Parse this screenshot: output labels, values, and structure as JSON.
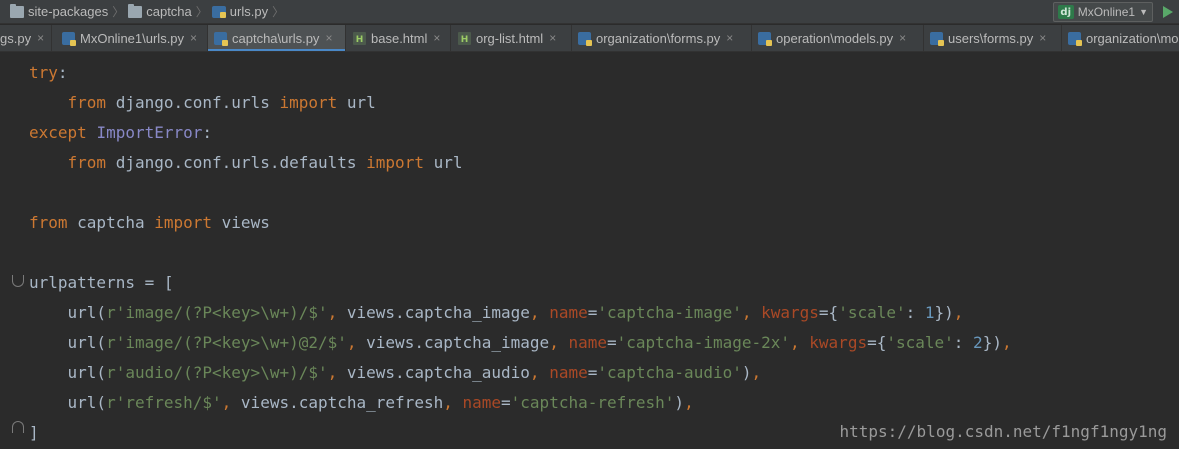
{
  "breadcrumb": {
    "items": [
      "site-packages",
      "captcha",
      "urls.py"
    ]
  },
  "run_config": {
    "icon_text": "dj",
    "label": "MxOnline1"
  },
  "tabs": [
    {
      "label": "gs.py",
      "type": "py",
      "active": false
    },
    {
      "label": "MxOnline1\\urls.py",
      "type": "py",
      "active": false
    },
    {
      "label": "captcha\\urls.py",
      "type": "py",
      "active": true
    },
    {
      "label": "base.html",
      "type": "html",
      "active": false
    },
    {
      "label": "org-list.html",
      "type": "html",
      "active": false
    },
    {
      "label": "organization\\forms.py",
      "type": "py",
      "active": false
    },
    {
      "label": "operation\\models.py",
      "type": "py",
      "active": false
    },
    {
      "label": "users\\forms.py",
      "type": "py",
      "active": false
    },
    {
      "label": "organization\\mo",
      "type": "py",
      "active": false
    }
  ],
  "tab_close_glyph": "×",
  "code": {
    "lines": [
      [
        {
          "t": "try",
          "c": "kw"
        },
        {
          "t": ":",
          "c": "op"
        }
      ],
      [
        {
          "t": "    ",
          "c": "op"
        },
        {
          "t": "from",
          "c": "kw"
        },
        {
          "t": " django.conf.urls ",
          "c": "op"
        },
        {
          "t": "import",
          "c": "kw"
        },
        {
          "t": " url",
          "c": "op"
        }
      ],
      [
        {
          "t": "except",
          "c": "kw"
        },
        {
          "t": " ",
          "c": "op"
        },
        {
          "t": "ImportError",
          "c": "cls"
        },
        {
          "t": ":",
          "c": "op"
        }
      ],
      [
        {
          "t": "    ",
          "c": "op"
        },
        {
          "t": "from",
          "c": "kw"
        },
        {
          "t": " django.conf.urls.defaults ",
          "c": "op"
        },
        {
          "t": "import",
          "c": "kw"
        },
        {
          "t": " url",
          "c": "op"
        }
      ],
      [],
      [
        {
          "t": "from",
          "c": "kw"
        },
        {
          "t": " captcha ",
          "c": "op"
        },
        {
          "t": "import",
          "c": "kw"
        },
        {
          "t": " views",
          "c": "op"
        }
      ],
      [],
      [
        {
          "t": "urlpatterns = [",
          "c": "op"
        }
      ],
      [
        {
          "t": "    url(",
          "c": "op"
        },
        {
          "t": "r'image/(?P<key>\\w+)/$'",
          "c": "str"
        },
        {
          "t": ", ",
          "c": "comma"
        },
        {
          "t": "views.captcha_image",
          "c": "op"
        },
        {
          "t": ", ",
          "c": "comma"
        },
        {
          "t": "name",
          "c": "kwarg"
        },
        {
          "t": "=",
          "c": "op"
        },
        {
          "t": "'captcha-image'",
          "c": "str"
        },
        {
          "t": ", ",
          "c": "comma"
        },
        {
          "t": "kwargs",
          "c": "kwarg"
        },
        {
          "t": "={",
          "c": "op"
        },
        {
          "t": "'scale'",
          "c": "str"
        },
        {
          "t": ": ",
          "c": "op"
        },
        {
          "t": "1",
          "c": "num"
        },
        {
          "t": "})",
          "c": "op"
        },
        {
          "t": ",",
          "c": "comma"
        }
      ],
      [
        {
          "t": "    url(",
          "c": "op"
        },
        {
          "t": "r'image/(?P<key>\\w+)@2/$'",
          "c": "str"
        },
        {
          "t": ", ",
          "c": "comma"
        },
        {
          "t": "views.captcha_image",
          "c": "op"
        },
        {
          "t": ", ",
          "c": "comma"
        },
        {
          "t": "name",
          "c": "kwarg"
        },
        {
          "t": "=",
          "c": "op"
        },
        {
          "t": "'captcha-image-2x'",
          "c": "str"
        },
        {
          "t": ", ",
          "c": "comma"
        },
        {
          "t": "kwargs",
          "c": "kwarg"
        },
        {
          "t": "={",
          "c": "op"
        },
        {
          "t": "'scale'",
          "c": "str"
        },
        {
          "t": ": ",
          "c": "op"
        },
        {
          "t": "2",
          "c": "num"
        },
        {
          "t": "})",
          "c": "op"
        },
        {
          "t": ",",
          "c": "comma"
        }
      ],
      [
        {
          "t": "    url(",
          "c": "op"
        },
        {
          "t": "r'audio/(?P<key>\\w+)/$'",
          "c": "str"
        },
        {
          "t": ", ",
          "c": "comma"
        },
        {
          "t": "views.captcha_audio",
          "c": "op"
        },
        {
          "t": ", ",
          "c": "comma"
        },
        {
          "t": "name",
          "c": "kwarg"
        },
        {
          "t": "=",
          "c": "op"
        },
        {
          "t": "'captcha-audio'",
          "c": "str"
        },
        {
          "t": ")",
          "c": "op"
        },
        {
          "t": ",",
          "c": "comma"
        }
      ],
      [
        {
          "t": "    url(",
          "c": "op"
        },
        {
          "t": "r'refresh/$'",
          "c": "str"
        },
        {
          "t": ", ",
          "c": "comma"
        },
        {
          "t": "views.captcha_refresh",
          "c": "op"
        },
        {
          "t": ", ",
          "c": "comma"
        },
        {
          "t": "name",
          "c": "kwarg"
        },
        {
          "t": "=",
          "c": "op"
        },
        {
          "t": "'captcha-refresh'",
          "c": "str"
        },
        {
          "t": ")",
          "c": "op"
        },
        {
          "t": ",",
          "c": "comma"
        }
      ],
      [
        {
          "t": "]",
          "c": "op"
        }
      ]
    ]
  },
  "watermark": "https://blog.csdn.net/f1ngf1ngy1ng",
  "colors": {
    "background": "#2b2b2b",
    "keyword": "#cc7832",
    "string": "#6a8759",
    "kwarg": "#aa4926",
    "number": "#6897bb",
    "builtin_class": "#8888c6",
    "default_text": "#a9b7c6",
    "active_tab_underline": "#4a88c7",
    "run_green": "#59a869"
  }
}
